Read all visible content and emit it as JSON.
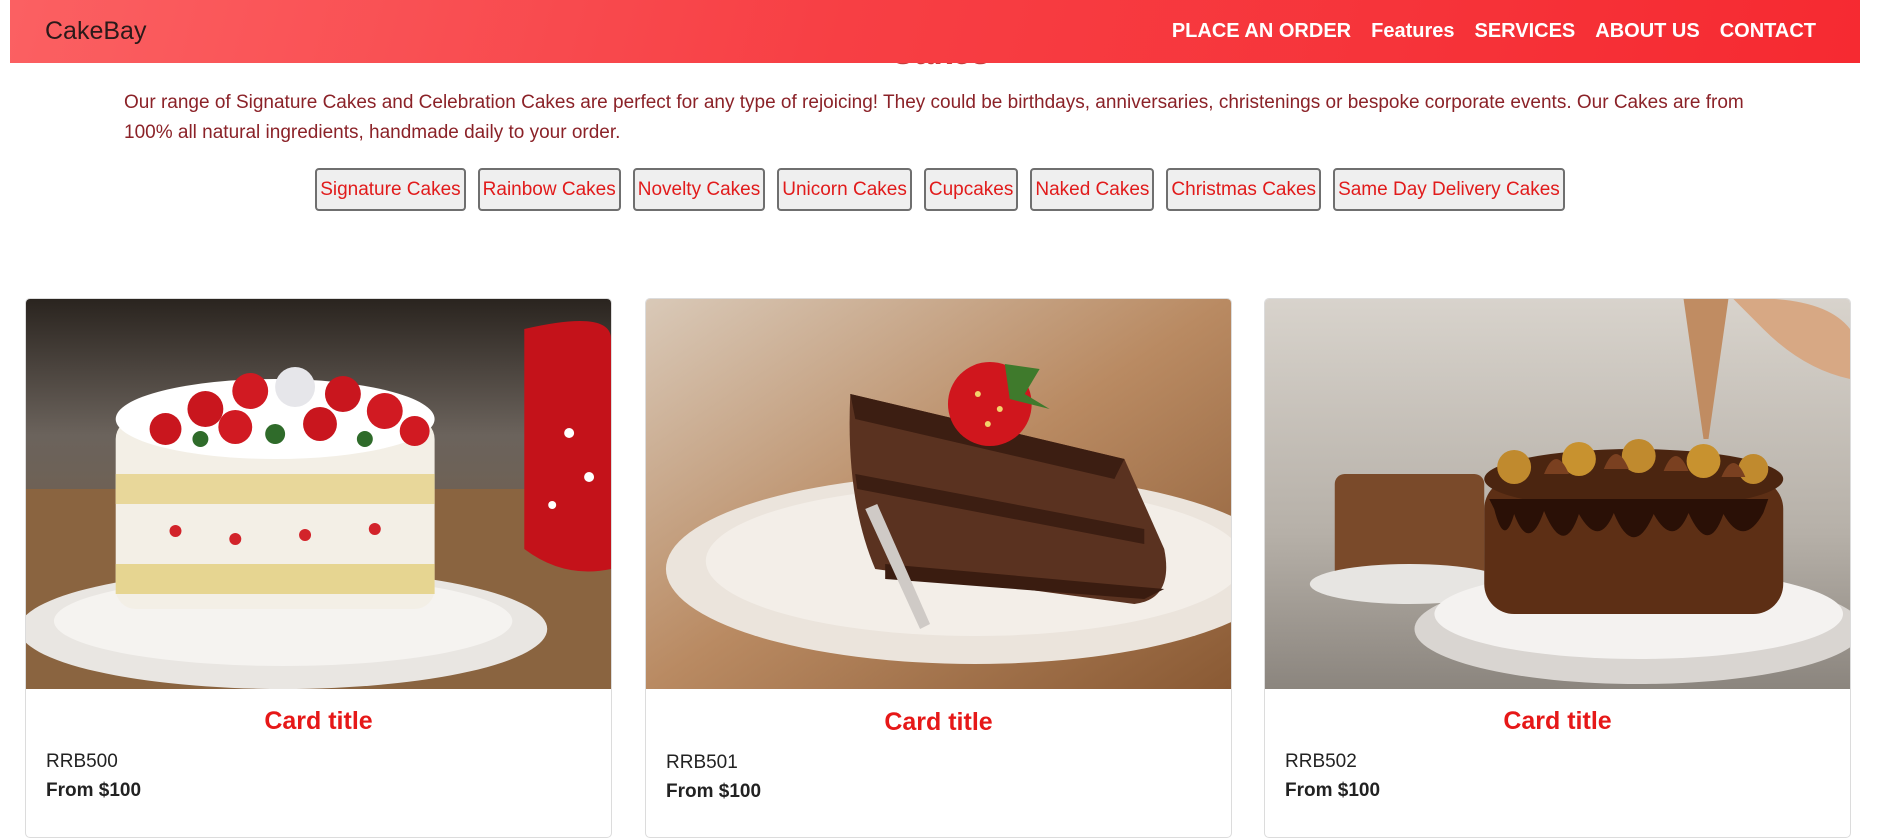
{
  "nav": {
    "brand": "CakeBay",
    "links": [
      "PLACE AN ORDER",
      "Features",
      "SERVICES",
      "ABOUT US",
      "CONTACT"
    ]
  },
  "section": {
    "heading": "Cakes",
    "intro": "Our range of Signature Cakes and Celebration Cakes are perfect for any type of rejoicing! They could be birthdays, anniversaries, christenings or bespoke corporate events. Our Cakes are from 100% all natural ingredients, handmade daily to your order."
  },
  "categories": [
    "Signature Cakes",
    "Rainbow Cakes",
    "Novelty Cakes",
    "Unicorn Cakes",
    "Cupcakes",
    "Naked Cakes",
    "Christmas Cakes",
    "Same Day Delivery Cakes"
  ],
  "cards": [
    {
      "title": "Card title",
      "code": "RRB500",
      "price": "From $100",
      "image": "strawberry-layer-cake-photo"
    },
    {
      "title": "Card title",
      "code": "RRB501",
      "price": "From $100",
      "image": "chocolate-cake-slice-photo"
    },
    {
      "title": "Card title",
      "code": "RRB502",
      "price": "From $100",
      "image": "chocolate-drip-cake-photo"
    }
  ],
  "colors": {
    "nav_gradient_start": "#fb6062",
    "nav_gradient_end": "#f62a31",
    "accent_red": "#e61818",
    "intro_text": "#8b2228"
  }
}
